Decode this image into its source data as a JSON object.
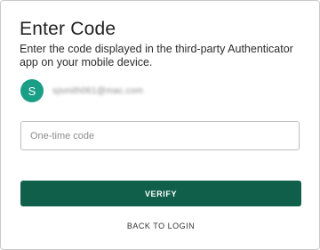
{
  "header": {
    "title": "Enter Code",
    "description": "Enter the code displayed in the third-party Authenticator app on your mobile device."
  },
  "account": {
    "avatar_letter": "S",
    "avatar_color": "#1a9e86",
    "email": "sjsmith061@mac.com"
  },
  "code_input": {
    "placeholder": "One-time code",
    "value": ""
  },
  "actions": {
    "verify_label": "VERIFY",
    "verify_color": "#0f5f4a",
    "back_label": "BACK TO LOGIN"
  }
}
